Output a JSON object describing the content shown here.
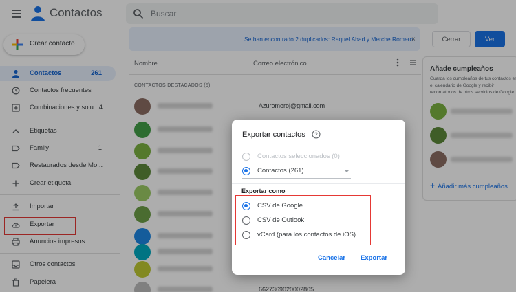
{
  "header": {
    "app_title": "Contactos",
    "search_placeholder": "Buscar"
  },
  "sidebar": {
    "create_label": "Crear contacto",
    "items": [
      {
        "label": "Contactos",
        "count": "261",
        "icon": "person-icon",
        "active": true
      },
      {
        "label": "Contactos frecuentes",
        "count": "",
        "icon": "history-icon"
      },
      {
        "label": "Combinaciones y solu...",
        "count": "4",
        "icon": "add-box-icon"
      },
      {
        "label": "Etiquetas",
        "count": "",
        "icon": "chevron-up-icon"
      },
      {
        "label": "Family",
        "count": "1",
        "icon": "label-icon"
      },
      {
        "label": "Restaurados desde Mo...",
        "count": "",
        "icon": "label-icon"
      },
      {
        "label": "Crear etiqueta",
        "count": "",
        "icon": "plus-icon"
      },
      {
        "label": "Importar",
        "count": "",
        "icon": "upload-icon"
      },
      {
        "label": "Exportar",
        "count": "",
        "icon": "cloud-download-icon"
      },
      {
        "label": "Anuncios impresos",
        "count": "",
        "icon": "print-icon"
      },
      {
        "label": "Otros contactos",
        "count": "",
        "icon": "inbox-icon"
      },
      {
        "label": "Papelera",
        "count": "",
        "icon": "trash-icon"
      }
    ]
  },
  "banner": {
    "text": "Se han encontrado 2 duplicados: Raquel Abad y Merche Romero.",
    "close_label": "Cerrar",
    "view_label": "Ver",
    "dismiss": "×"
  },
  "table": {
    "col_name": "Nombre",
    "col_email": "Correo electrónico",
    "section": "CONTACTOS DESTACADOS (5)",
    "rows": [
      {
        "email": "Azuromeroj@gmail.com",
        "avatar": "#8d6e63"
      },
      {
        "email": "",
        "avatar": "#43a047"
      },
      {
        "email": "",
        "avatar": "#7cb342"
      },
      {
        "email": "",
        "avatar": "#5d8a3a"
      },
      {
        "email": "",
        "avatar": "#9ccc65"
      },
      {
        "email": "",
        "avatar": "#6d9f48"
      },
      {
        "email": "",
        "avatar": "#1e88e5"
      },
      {
        "email": "",
        "avatar": "#00acc1"
      },
      {
        "email": "",
        "avatar": "#c0ca33"
      },
      {
        "email": "6627369020002805",
        "avatar": "#bdbdbd"
      }
    ]
  },
  "birthdays": {
    "title": "Añade cumpleaños",
    "description": "Guarda los cumpleaños de tus contactos en el calendario de Google y recibir recordatorios de otros servicios de Google",
    "add_label": "Añadir más cumpleaños",
    "avatars": [
      "#7cb342",
      "#5d8a3a",
      "#8d6e63"
    ]
  },
  "dialog": {
    "title": "Exportar contactos",
    "option_selected": "Contactos seleccionados (0)",
    "option_all": "Contactos (261)",
    "export_as": "Exportar como",
    "format_google": "CSV de Google",
    "format_outlook": "CSV de Outlook",
    "format_vcard": "vCard (para los contactos de iOS)",
    "cancel_label": "Cancelar",
    "export_label": "Exportar"
  },
  "colors": {
    "accent": "#1a73e8",
    "highlight": "#e53935"
  }
}
